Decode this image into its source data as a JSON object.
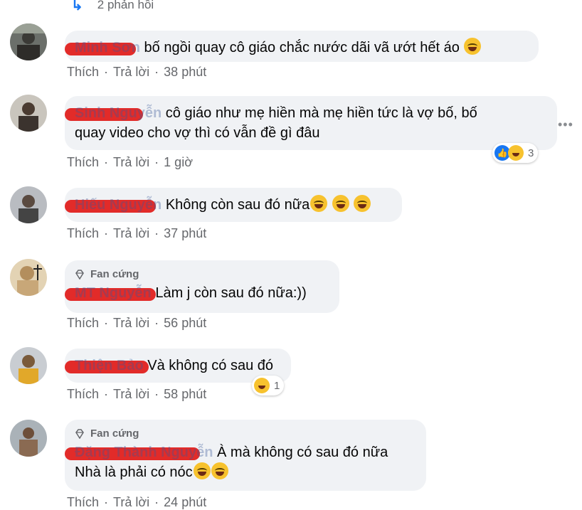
{
  "top_reply": {
    "label": "2 phản hồi"
  },
  "comments": [
    {
      "name": "Minh Sơn",
      "text": "bố ngồi quay cô giáo chắc nước dãi vã ướt hết áo",
      "emojis": 1,
      "like": "Thích",
      "reply": "Trả lời",
      "time": "38 phút"
    },
    {
      "name": "Sinh Nguyễn",
      "text_line1": "cô giáo như mẹ hiền mà mẹ hiền tức là vợ bố, bố",
      "text_line2": "quay video cho vợ thì có vẫn đề gì đâu",
      "like": "Thích",
      "reply": "Trả lời",
      "time": "1 giờ",
      "reaction_count": "3"
    },
    {
      "name": "Hiếu Nguyễn",
      "text": "Không còn sau đó nữa",
      "like": "Thích",
      "reply": "Trả lời",
      "time": "37 phút"
    },
    {
      "badge": "Fan cứng",
      "name": "MT Nguyễn",
      "text": "Làm j còn sau đó nữa:))",
      "like": "Thích",
      "reply": "Trả lời",
      "time": "56 phút"
    },
    {
      "name": "Thiện Bảo",
      "text": "Và không có sau đó",
      "like": "Thích",
      "reply": "Trả lời",
      "time": "58 phút",
      "reaction_count": "1"
    },
    {
      "badge": "Fan cứng",
      "name": "Đặng Thành Nguyễn",
      "text_line1": "À mà không có sau đó nữa",
      "text_line2": "Nhà là phải có nóc",
      "like": "Thích",
      "reply": "Trả lời",
      "time": "24 phút"
    }
  ],
  "separator": "·",
  "more_label": "•••",
  "colors": {
    "bubble": "#f0f2f5",
    "name": "#385898",
    "meta": "#65676b",
    "accent": "#1877f2",
    "redaction": "#e0201e"
  }
}
